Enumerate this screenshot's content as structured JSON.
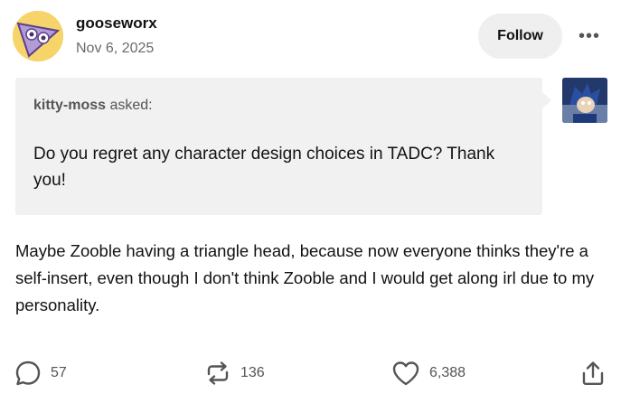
{
  "post": {
    "author": "gooseworx",
    "date": "Nov 6, 2025",
    "follow_label": "Follow",
    "more_label": "•••"
  },
  "ask": {
    "asker": "kitty-moss",
    "asked_label": " asked:",
    "question": "Do you regret any character design choices in TADC? Thank you!"
  },
  "answer": "Maybe Zooble having a triangle head, because now everyone thinks they're a self-insert, even though I don't think Zooble and I would get along irl due to my personality.",
  "footer": {
    "comments": "57",
    "reblogs": "136",
    "likes": "6,388"
  },
  "icons": {
    "comment": "comment-icon",
    "reblog": "reblog-icon",
    "like": "heart-icon",
    "share": "share-icon"
  }
}
